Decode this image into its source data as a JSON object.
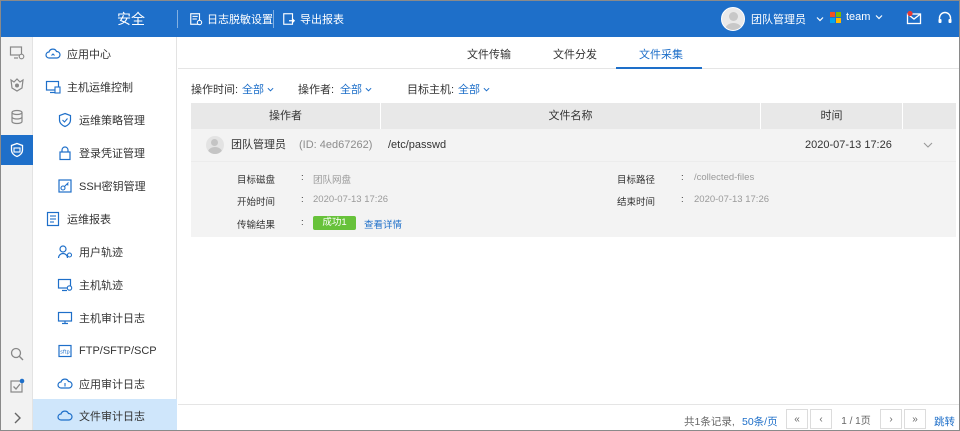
{
  "header": {
    "brand": "安全",
    "log_mask_label": "日志脱敏设置",
    "export_label": "导出报表",
    "user_name": "团队管理员",
    "team_label": "team",
    "accent": "#1e6fc9"
  },
  "sidebar": {
    "items": [
      {
        "label": "应用中心",
        "icon": "cloud-icon"
      },
      {
        "label": "主机运维控制",
        "icon": "monitor-icon"
      },
      {
        "label": "运维策略管理",
        "icon": "shield-icon"
      },
      {
        "label": "登录凭证管理",
        "icon": "lock-icon"
      },
      {
        "label": "SSH密钥管理",
        "icon": "key-icon"
      },
      {
        "label": "运维报表",
        "icon": "report-icon"
      },
      {
        "label": "用户轨迹",
        "icon": "user-track-icon"
      },
      {
        "label": "主机轨迹",
        "icon": "host-track-icon"
      },
      {
        "label": "主机审计日志",
        "icon": "host-audit-icon"
      },
      {
        "label": "FTP/SFTP/SCP",
        "icon": "ftp-icon"
      },
      {
        "label": "应用审计日志",
        "icon": "app-audit-icon"
      },
      {
        "label": "文件审计日志",
        "icon": "file-audit-icon"
      }
    ]
  },
  "tabs": [
    {
      "label": "文件传输"
    },
    {
      "label": "文件分发"
    },
    {
      "label": "文件采集"
    }
  ],
  "filters": {
    "time_label": "操作时间:",
    "time_value": "全部",
    "operator_label": "操作者:",
    "operator_value": "全部",
    "host_label": "目标主机:",
    "host_value": "全部"
  },
  "table": {
    "columns": [
      "操作者",
      "文件名称",
      "时间"
    ],
    "row": {
      "operator": "团队管理员",
      "id": "(ID: 4ed67262)",
      "file": "/etc/passwd",
      "time": "2020-07-13 17:26"
    },
    "detail": {
      "disk_label": "目标磁盘",
      "disk_value": "团队网盘",
      "path_label": "目标路径",
      "path_value": "/collected-files",
      "start_label": "开始时间",
      "start_value": "2020-07-13 17:26",
      "end_label": "结束时间",
      "end_value": "2020-07-13 17:26",
      "result_label": "传输结果",
      "result_badge": "成功1",
      "view_detail": "查看详情",
      "colon": ":",
      "success_color": "#67c23a"
    }
  },
  "pagination": {
    "summary": "共1条记录,",
    "page_size": "50条/页",
    "first": "«",
    "prev": "‹",
    "page": "1 / 1页",
    "next": "›",
    "last": "»",
    "goto": "跳转"
  }
}
